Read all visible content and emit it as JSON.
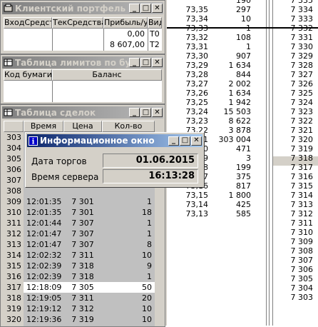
{
  "ladder": {
    "prices": [
      "73,35",
      "73,34",
      "73,33",
      "73,32",
      "73,31",
      "73,30",
      "73,29",
      "73,28",
      "73,27",
      "73,26",
      "73,25",
      "73,24",
      "73,23",
      "73,22",
      "73,21",
      "73,20",
      "73,19",
      "73,18",
      "73,17",
      "73,16",
      "73,15",
      "73,14",
      "73,13"
    ],
    "volumes": [
      "297",
      "10",
      "1",
      "108",
      "1",
      "907",
      "1 634",
      "844",
      "2 002",
      "1 634",
      "1 942",
      "15 503",
      "8 622",
      "3 878",
      "303 004",
      "471",
      "3",
      "199",
      "375",
      "817",
      "1 800",
      "425",
      "585"
    ],
    "top_partial": [
      "",
      "190"
    ],
    "right_prices": [
      "7 334",
      "7 333",
      "7 332",
      "7 331",
      "7 330",
      "7 329",
      "7 328",
      "7 327",
      "7 326",
      "7 325",
      "7 324",
      "7 323",
      "7 322",
      "7 321",
      "7 320",
      "7 319",
      "7 318",
      "7 317",
      "7 316",
      "7 315",
      "7 314",
      "7 313",
      "7 312",
      "7 311",
      "7 310",
      "7 309",
      "7 308",
      "7 307",
      "7 306",
      "7 305",
      "7 304",
      "7 303"
    ],
    "right_top_partial": "7 335",
    "selected_price": "7 319"
  },
  "portfolio": {
    "title": "Клиентский портфель",
    "columns": [
      "ВходСредства",
      "ТекСредства",
      "Прибыль/убытки",
      "Вид"
    ],
    "rows": [
      {
        "in": "",
        "cur": "",
        "profit": "0,00",
        "kind": "T0"
      },
      {
        "in": "",
        "cur": "",
        "profit": "8 607,00",
        "kind": "T2"
      }
    ]
  },
  "limits": {
    "title": "Таблица лимитов по бумагам",
    "columns": [
      "Код бумаги",
      "Баланс"
    ]
  },
  "trades": {
    "title": "Таблица сделок",
    "columns": [
      "",
      "Время",
      "Цена",
      "Кол-во"
    ],
    "selected_index": 14,
    "rows": [
      {
        "n": "303",
        "time": "",
        "price": "",
        "qty": ""
      },
      {
        "n": "304",
        "time": "",
        "price": "",
        "qty": ""
      },
      {
        "n": "305",
        "time": "",
        "price": "",
        "qty": ""
      },
      {
        "n": "306",
        "time": "",
        "price": "",
        "qty": ""
      },
      {
        "n": "307",
        "time": "",
        "price": "",
        "qty": ""
      },
      {
        "n": "308",
        "time": "",
        "price": "",
        "qty": ""
      },
      {
        "n": "309",
        "time": "12:01:35",
        "price": "7 301",
        "qty": "1"
      },
      {
        "n": "310",
        "time": "12:01:35",
        "price": "7 301",
        "qty": "18"
      },
      {
        "n": "311",
        "time": "12:01:44",
        "price": "7 307",
        "qty": "1"
      },
      {
        "n": "312",
        "time": "12:01:47",
        "price": "7 307",
        "qty": "1"
      },
      {
        "n": "313",
        "time": "12:01:47",
        "price": "7 307",
        "qty": "8"
      },
      {
        "n": "314",
        "time": "12:02:32",
        "price": "7 311",
        "qty": "10"
      },
      {
        "n": "315",
        "time": "12:02:39",
        "price": "7 318",
        "qty": "9"
      },
      {
        "n": "316",
        "time": "12:02:39",
        "price": "7 318",
        "qty": "1"
      },
      {
        "n": "317",
        "time": "12:18:09",
        "price": "7 305",
        "qty": "50"
      },
      {
        "n": "318",
        "time": "12:19:05",
        "price": "7 311",
        "qty": "20"
      },
      {
        "n": "319",
        "time": "12:19:12",
        "price": "7 312",
        "qty": "10"
      },
      {
        "n": "320",
        "time": "12:19:36",
        "price": "7 319",
        "qty": "10"
      }
    ]
  },
  "info": {
    "title": "Информационное окно",
    "date_label": "Дата торгов",
    "date_value": "01.06.2015",
    "time_label": "Время сервера",
    "time_value": "16:13:28"
  },
  "colors": {
    "titlebar_active": "#0a246a",
    "titlebar_inactive": "#808080",
    "face": "#d4d0c8",
    "trade_col_bg": "#c0c0c0"
  }
}
